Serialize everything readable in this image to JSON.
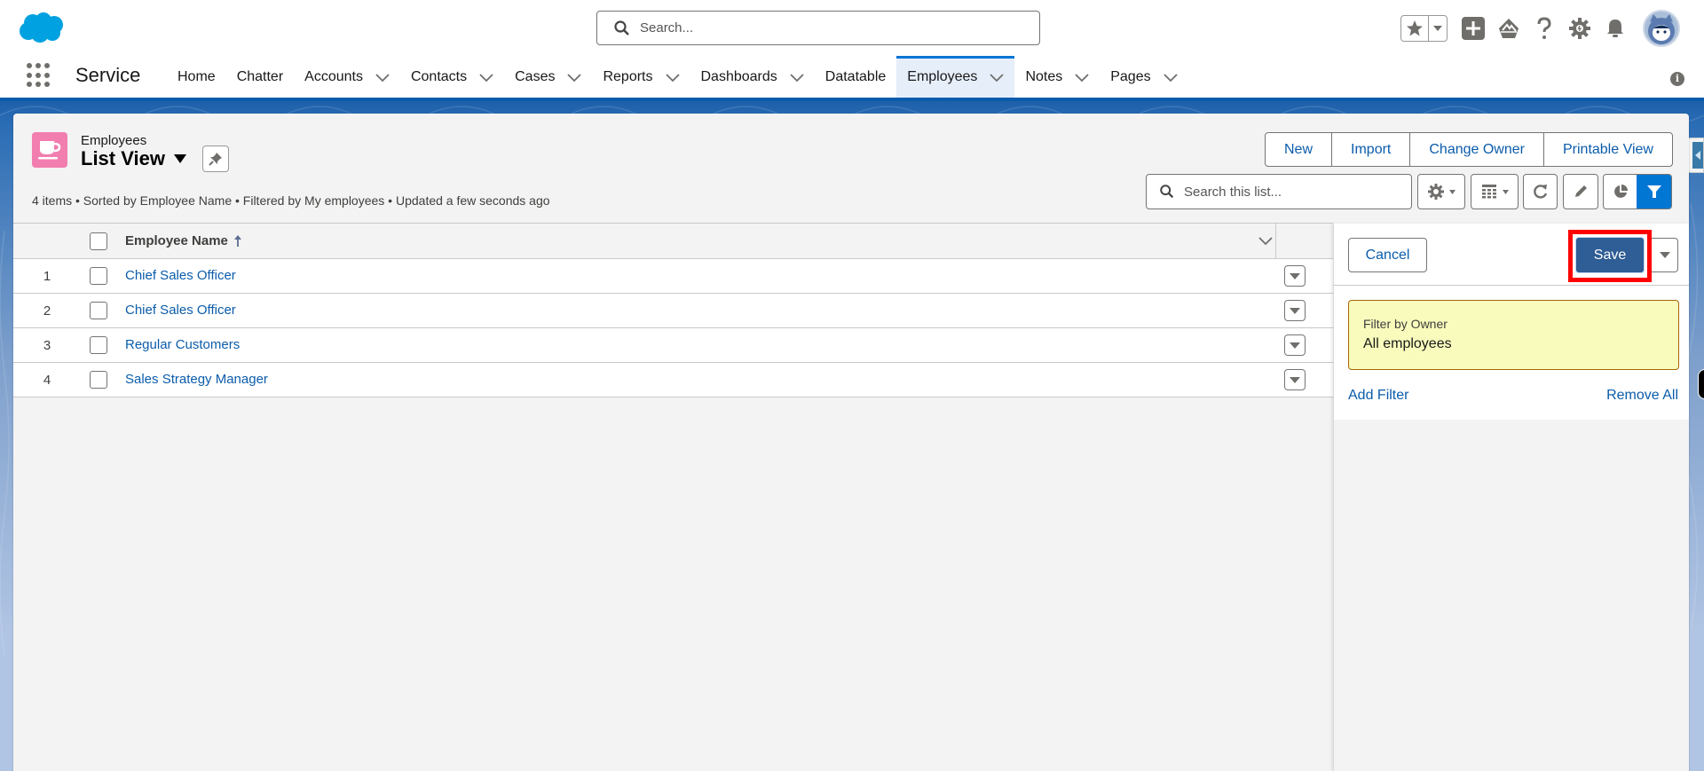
{
  "global_header": {
    "search_placeholder": "Search...",
    "icons": [
      "salesforce-cloud-logo",
      "favorites-star-icon",
      "favorites-dropdown-icon",
      "global-actions-plus-icon",
      "trailhead-guidance-icon",
      "help-question-icon",
      "setup-gear-icon",
      "notifications-bell-icon",
      "user-avatar"
    ]
  },
  "nav": {
    "app_name": "Service",
    "items": [
      {
        "label": "Home",
        "has_menu": false,
        "active": false
      },
      {
        "label": "Chatter",
        "has_menu": false,
        "active": false
      },
      {
        "label": "Accounts",
        "has_menu": true,
        "active": false
      },
      {
        "label": "Contacts",
        "has_menu": true,
        "active": false
      },
      {
        "label": "Cases",
        "has_menu": true,
        "active": false
      },
      {
        "label": "Reports",
        "has_menu": true,
        "active": false
      },
      {
        "label": "Dashboards",
        "has_menu": true,
        "active": false
      },
      {
        "label": "Datatable",
        "has_menu": false,
        "active": false
      },
      {
        "label": "Employees",
        "has_menu": true,
        "active": true
      },
      {
        "label": "Notes",
        "has_menu": true,
        "active": false
      },
      {
        "label": "Pages",
        "has_menu": true,
        "active": false
      }
    ],
    "info_icon": "i"
  },
  "list_header": {
    "object_label": "Employees",
    "list_view_name": "List View",
    "info_line": "4 items • Sorted by Employee Name • Filtered by My employees • Updated a few seconds ago",
    "actions": [
      "New",
      "Import",
      "Change Owner",
      "Printable View"
    ],
    "search_placeholder": "Search this list..."
  },
  "table": {
    "columns": [
      {
        "label": "Employee Name",
        "sort": "ascending"
      }
    ],
    "rows": [
      {
        "num": "1",
        "name": "Chief Sales Officer"
      },
      {
        "num": "2",
        "name": "Chief Sales Officer"
      },
      {
        "num": "3",
        "name": "Regular Customers"
      },
      {
        "num": "4",
        "name": "Sales Strategy Manager"
      }
    ]
  },
  "filter_panel": {
    "cancel_label": "Cancel",
    "save_label": "Save",
    "filters": [
      {
        "label": "Filter by Owner",
        "value": "All employees"
      }
    ],
    "add_filter_label": "Add Filter",
    "remove_all_label": "Remove All"
  },
  "colors": {
    "brand_blue": "#0176d3",
    "link_blue": "#0b5cab",
    "save_button": "#2f5d95",
    "highlight_red": "#ff0000",
    "object_icon_pink": "#f27daf",
    "filter_card_bg": "#f8fbbc"
  }
}
